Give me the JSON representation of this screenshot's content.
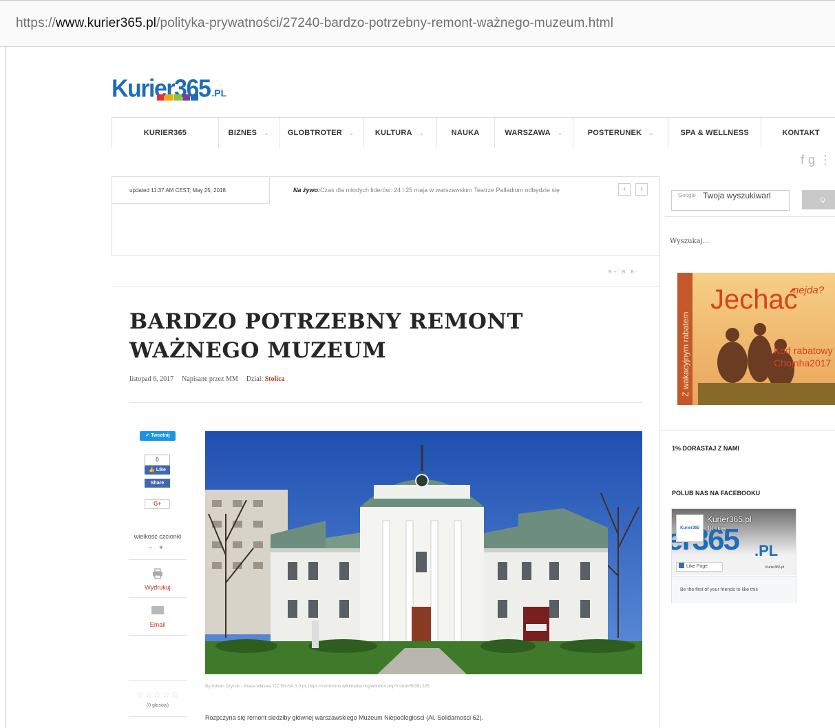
{
  "browser": {
    "url_scheme": "https://",
    "url_host": "www.kurier365.pl",
    "url_path": "/polityka-prywatności/27240-bardzo-potrzebny-remont-ważnego-muzeum.html"
  },
  "logo": {
    "main": "Kurier365",
    "suffix": ".PL"
  },
  "nav": {
    "items": [
      {
        "label": "KURIER365",
        "dropdown": false
      },
      {
        "label": "BIZNES",
        "dropdown": true
      },
      {
        "label": "GLOBTROTER",
        "dropdown": true
      },
      {
        "label": "KULTURA",
        "dropdown": true
      },
      {
        "label": "NAUKA",
        "dropdown": false
      },
      {
        "label": "WARSZAWA",
        "dropdown": true
      },
      {
        "label": "POSTERUNEK",
        "dropdown": true
      },
      {
        "label": "SPA & WELLNESS",
        "dropdown": false
      },
      {
        "label": "KONTAKT",
        "dropdown": false
      }
    ]
  },
  "social_icons": [
    "facebook-icon",
    "google-plus-icon",
    "more-icon"
  ],
  "ticker": {
    "updated": "updated 11:37 AM CEST, May 25, 2018",
    "live_label": "Na żywo:",
    "text": "Czas dla młodych liderów: 24 i 25 maja w warszawskim Teatrze Palladium odbędzie się",
    "prev": "‹",
    "next": "›"
  },
  "search": {
    "provider": "Google",
    "value": "Twoja wyszukiwarl",
    "button": "Q",
    "label": "Wyszukaj..."
  },
  "font_size_row": "B+ B B-",
  "article": {
    "title": "BARDZO POTRZEBNY REMONT WAŻNEGO MUZEUM",
    "date": "listopad 6, 2017",
    "author": "Napisane przez MM",
    "section_label": "Dział:",
    "section": "Stolica",
    "caption": "By Adrian Grycuk - Praca własna, CC BY-SA 3.0 pl, https://commons.wikimedia.org/w/index.php?curid=59351225",
    "body": "Rozpczyna się remont siedziby głównej warszawskiego Muzeum Niepodległości (Al. Solidarności 62)."
  },
  "share": {
    "tweet": "Tweetnij",
    "fb_count": "0",
    "fb_like": "Like",
    "fb_share": "Share",
    "gplus": "G+",
    "font_size_label": "wielkość czcionki",
    "font_size_controls": "- +",
    "print": "Wydrukuj",
    "email": "Email",
    "stars": "☆☆☆☆☆",
    "votes": "(0 głosów)"
  },
  "ad": {
    "headline": "Jechać",
    "sub": "nejda?",
    "vertical": "Z wakacyjnym rabatem",
    "code_line1": "Kod rabatowy",
    "code_line2": "Chojnha2017"
  },
  "sidebar": {
    "one_percent": "1% DORASTAJ Z NAMI",
    "fb_heading": "POLUB NAS NA FACEBOOKU",
    "fb_page_name": "Kurier365.pl",
    "fb_likes": "1K likes",
    "fb_like_page": "Like Page",
    "fb_mini": "Kurier365.pl",
    "fb_friends": "Be the first of your friends to like this",
    "fb_cover_big": "er365",
    "fb_cover_pl": ".PL",
    "fb_thumb": "Kurier365"
  },
  "colors": {
    "brand_blue": "#1f6db8",
    "accent_red": "#c0392b",
    "twitter": "#1b95e0",
    "facebook": "#4267b2"
  }
}
